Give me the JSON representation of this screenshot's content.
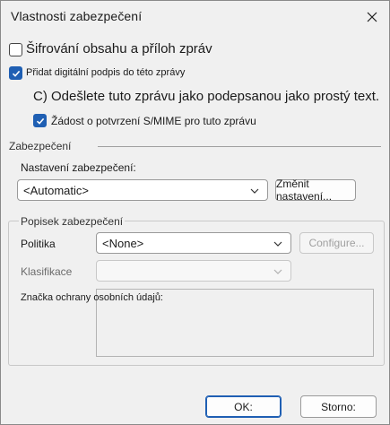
{
  "dialog": {
    "title": "Vlastnosti zabezpečení",
    "close_icon": "close-icon"
  },
  "options": {
    "encrypt_label": "Šifrování obsahu a příloh zpráv",
    "encrypt_checked": false,
    "sign_label": "Přidat digitální podpis do této zprávy",
    "sign_checked": true,
    "plaintext_label": "C) Odešlete tuto zprávu jako podepsanou jako prostý text.",
    "smime_label": "Žádost o potvrzení S/MIME pro tuto zprávu",
    "smime_checked": true
  },
  "security": {
    "section_label": "Zabezpečení",
    "settings_label": "Nastavení zabezpečení:",
    "settings_value": "<Automatic>",
    "change_button": "Změnit nastavení..."
  },
  "label_section": {
    "group_label": "Popisek zabezpečení",
    "policy_label": "Politika",
    "policy_value": "<None>",
    "configure_button": "Configure...",
    "classification_label": "Klasifikace",
    "classification_value": "",
    "privacy_label": "Značka ochrany osobních údajů:",
    "privacy_value": ""
  },
  "footer": {
    "ok_button": "OK:",
    "cancel_button": "Storno:"
  },
  "colors": {
    "accent": "#1f5fb3",
    "background": "#f0f0f0"
  }
}
